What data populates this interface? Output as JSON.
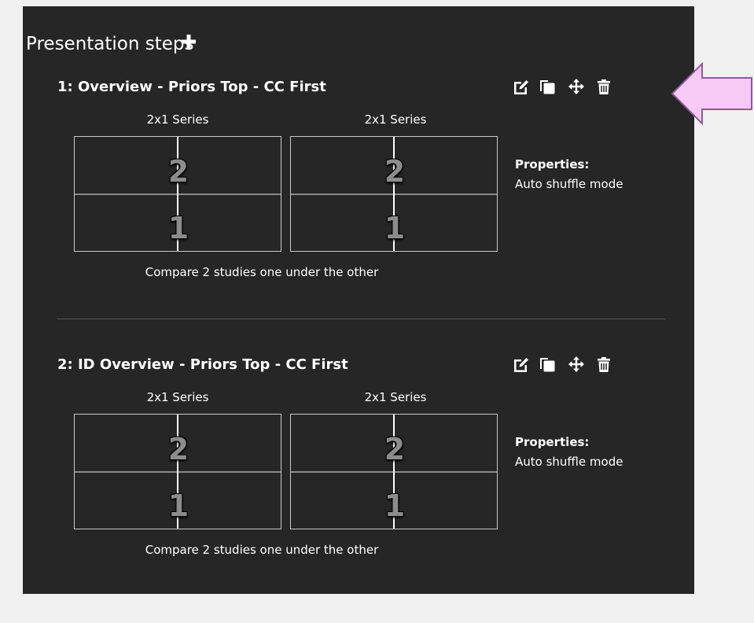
{
  "panel": {
    "title": "Presentation steps",
    "background": "#262626"
  },
  "icons": {
    "add": "plus-icon",
    "edit": "edit-icon",
    "copy": "copy-icon",
    "move": "move-icon",
    "delete": "trash-icon"
  },
  "steps": [
    {
      "title": "1: Overview - Priors Top - CC First",
      "layouts": [
        {
          "label": "2x1 Series",
          "top_number": "2",
          "bottom_number": "1"
        },
        {
          "label": "2x1 Series",
          "top_number": "2",
          "bottom_number": "1"
        }
      ],
      "properties_label": "Properties:",
      "properties_value": "Auto shuffle mode",
      "description": "Compare 2 studies one under the other"
    },
    {
      "title": "2: ID Overview - Priors Top - CC First",
      "layouts": [
        {
          "label": "2x1 Series",
          "top_number": "2",
          "bottom_number": "1"
        },
        {
          "label": "2x1 Series",
          "top_number": "2",
          "bottom_number": "1"
        }
      ],
      "properties_label": "Properties:",
      "properties_value": "Auto shuffle mode",
      "description": "Compare 2 studies one under the other"
    }
  ],
  "callout": {
    "fill": "#f7c9f5",
    "stroke": "#8b5d96"
  }
}
